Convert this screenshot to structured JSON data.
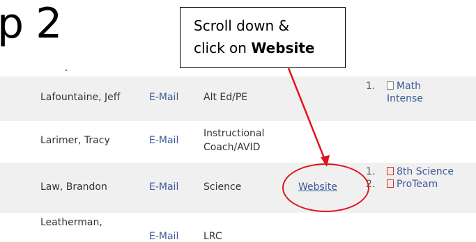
{
  "slide": {
    "title_fragment": "p 2"
  },
  "callout": {
    "line1": "Scroll down &",
    "line2_prefix": "click on ",
    "line2_bold": "Website"
  },
  "rows": [
    {
      "name": "Lafountaine, Jeff",
      "email": "E-Mail",
      "dept": "Alt Ed/PE",
      "website": "",
      "links": [
        {
          "num": "1.",
          "icon": "document-icon",
          "text": "Math Intense"
        }
      ]
    },
    {
      "name": "Larimer, Tracy",
      "email": "E-Mail",
      "dept": "Instructional Coach/AVID",
      "website": "",
      "links": []
    },
    {
      "name": "Law, Brandon",
      "email": "E-Mail",
      "dept": "Science",
      "website": "Website",
      "links": [
        {
          "num": "1.",
          "icon": "pdf-icon",
          "text": "8th Science"
        },
        {
          "num": "2.",
          "icon": "pdf-icon",
          "text": "ProTeam"
        }
      ]
    },
    {
      "name": "Leatherman,",
      "email": "E-Mail",
      "dept": "LRC",
      "website": "",
      "links": []
    }
  ],
  "colors": {
    "link": "#3b5998",
    "annotation": "#e0141e",
    "row_shade": "#f0f0f0"
  }
}
